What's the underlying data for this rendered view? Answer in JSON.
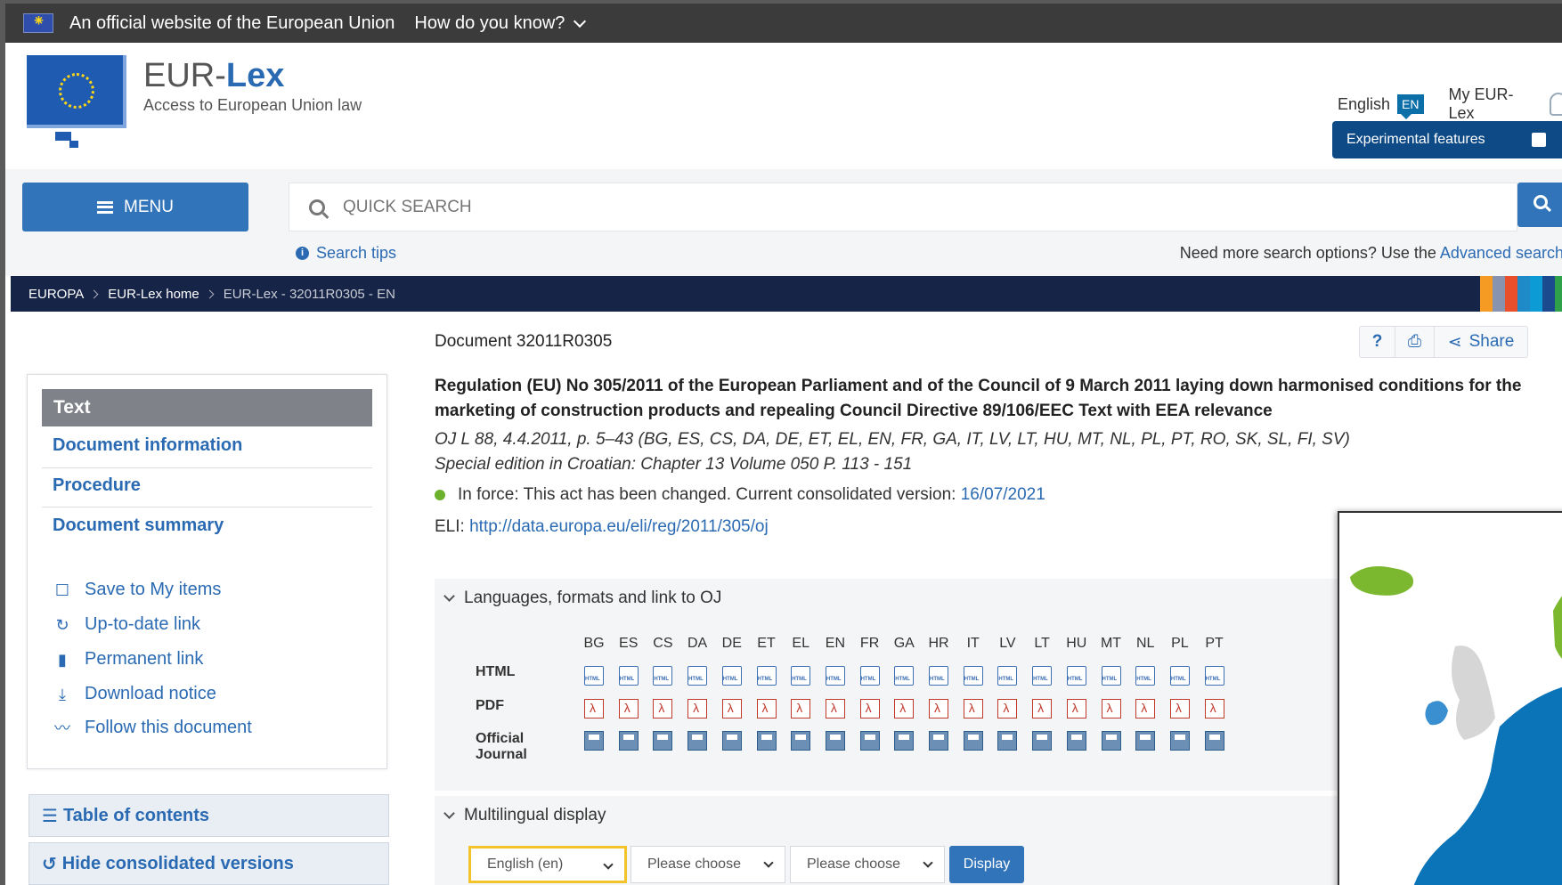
{
  "eu_banner": {
    "official_text": "An official website of the European Union",
    "how_know": "How do you know?"
  },
  "header": {
    "brand_prefix": "EUR-",
    "brand_bold": "Lex",
    "brand_sub": "Access to European Union law",
    "language": "English",
    "language_code": "EN",
    "my_eurlex": "My EUR-Lex",
    "experimental": "Experimental features"
  },
  "search": {
    "menu_label": "MENU",
    "placeholder": "QUICK SEARCH",
    "tips": "Search tips",
    "more_options": "Need more search options? Use the",
    "advanced_link": "Advanced search"
  },
  "breadcrumb": {
    "items": [
      "EUROPA",
      "EUR-Lex home",
      "EUR-Lex - 32011R0305 - EN"
    ]
  },
  "colors": {
    "accent": "#2a6ab3",
    "button": "#3174b9",
    "dark_band": "#162447",
    "stripes": [
      "#f59a23",
      "#8893b0",
      "#e94f2b",
      "#1e8ac8",
      "#0d9bd6",
      "#1c4a8f",
      "#2fa14b"
    ]
  },
  "sidebar": {
    "active": "Text",
    "links": [
      "Document information",
      "Procedure",
      "Document summary"
    ],
    "tools": [
      {
        "icon": "bookmark-outline-icon",
        "label": "Save to My items"
      },
      {
        "icon": "refresh-icon",
        "label": "Up-to-date link"
      },
      {
        "icon": "bookmark-icon",
        "label": "Permanent link"
      },
      {
        "icon": "download-icon",
        "label": "Download notice"
      },
      {
        "icon": "rss-icon",
        "label": "Follow this document"
      }
    ],
    "toc": "Table of contents",
    "hide_consolidated": "Hide consolidated versions"
  },
  "document": {
    "id_label": "Document 32011R0305",
    "help": "?",
    "share": "Share",
    "title": "Regulation (EU) No 305/2011 of the European Parliament and of the Council of 9 March 2011 laying down harmonised conditions for the marketing of construction products and repealing Council Directive 89/106/EEC Text with EEA relevance",
    "oj": "OJ L 88, 4.4.2011, p. 5–43 (BG, ES, CS, DA, DE, ET, EL, EN, FR, GA, IT, LV, LT, HU, MT, NL, PL, PT, RO, SK, SL, FI, SV)",
    "special_edition": "Special edition in Croatian: Chapter 13 Volume 050 P. 113 - 151",
    "in_force_text": "In force: This act has been changed. Current consolidated version:",
    "in_force_date": "16/07/2021",
    "eli_label": "ELI:",
    "eli_link": "http://data.europa.eu/eli/reg/2011/305/oj"
  },
  "formats": {
    "heading": "Languages, formats and link to OJ",
    "languages": [
      "BG",
      "ES",
      "CS",
      "DA",
      "DE",
      "ET",
      "EL",
      "EN",
      "FR",
      "GA",
      "HR",
      "IT",
      "LV",
      "LT",
      "HU",
      "MT",
      "NL",
      "PL",
      "PT"
    ],
    "rows": [
      "HTML",
      "PDF",
      "Official Journal"
    ]
  },
  "multilingual": {
    "heading": "Multilingual display",
    "select1": "English (en)",
    "select2": "Please choose",
    "select3": "Please choose",
    "display": "Display"
  }
}
